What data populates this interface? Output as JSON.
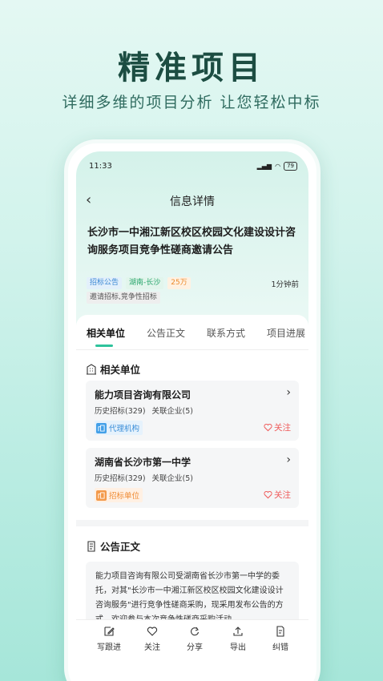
{
  "hero": {
    "title": "精准项目",
    "subtitle": "详细多维的项目分析 让您轻松中标"
  },
  "status_bar": {
    "time": "11:33",
    "battery": "79"
  },
  "navbar": {
    "title": "信息详情"
  },
  "project": {
    "title": "长沙市一中湘江新区校区校园文化建设设计咨询服务项目竞争性磋商邀请公告",
    "tags": [
      "招标公告",
      "湖南-长沙",
      "25万"
    ],
    "time_ago": "1分钟前",
    "category": "邀请招标,竞争性招标"
  },
  "tabs": [
    "相关单位",
    "公告正文",
    "联系方式",
    "项目进展"
  ],
  "related": {
    "heading": "相关单位",
    "units": [
      {
        "name": "能力项目咨询有限公司",
        "history": "历史招标(329)",
        "linked": "关联企业(5)",
        "role": "代理机构",
        "follow": "关注"
      },
      {
        "name": "湖南省长沙市第一中学",
        "history": "历史招标(329)",
        "linked": "关联企业(5)",
        "role": "招标单位",
        "follow": "关注"
      }
    ]
  },
  "notice": {
    "heading": "公告正文",
    "body": "能力项目咨询有限公司受湖南省长沙市第一中学的委托，对其\"长沙市一中湘江新区校区校园文化建设设计咨询服务\"进行竞争性磋商采购，现采用发布公告的方式，欢迎参与本次竞争性磋商采购活动。"
  },
  "toolbar": [
    "写跟进",
    "关注",
    "分享",
    "导出",
    "纠错"
  ],
  "colors": {
    "accent": "#2ec39c",
    "follow": "#ef5a5a",
    "heading": "#1c4d42"
  }
}
